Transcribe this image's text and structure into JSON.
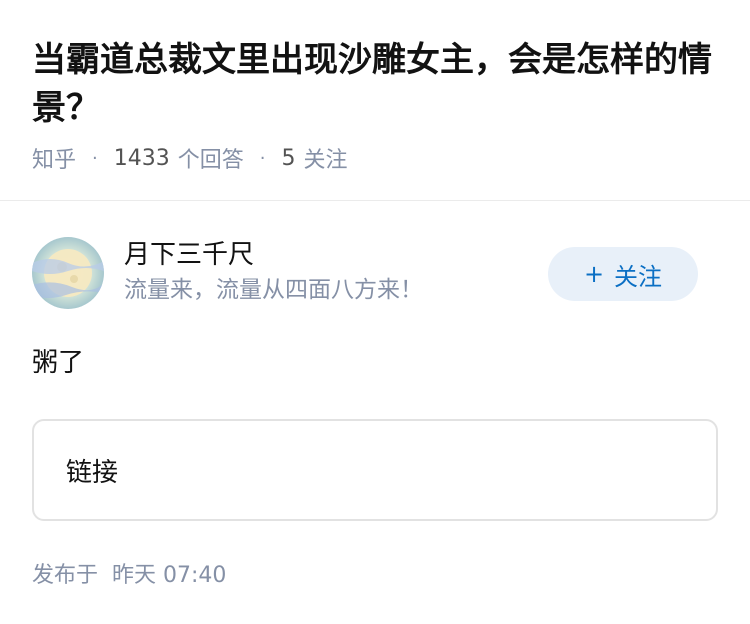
{
  "question": {
    "title": "当霸道总裁文里出现沙雕女主，会是怎样的情景？",
    "source": "知乎",
    "answers_count": "1433",
    "answers_label": "个回答",
    "followers_count": "5",
    "followers_label": "关注"
  },
  "author": {
    "name": "月下三千尺",
    "bio": "流量来，流量从四面八方来！",
    "follow_icon": "plus-icon",
    "follow_label": "关注"
  },
  "answer": {
    "text": "粥了",
    "link_label": "链接"
  },
  "publish": {
    "label": "发布于",
    "time": "昨天 07:40"
  }
}
